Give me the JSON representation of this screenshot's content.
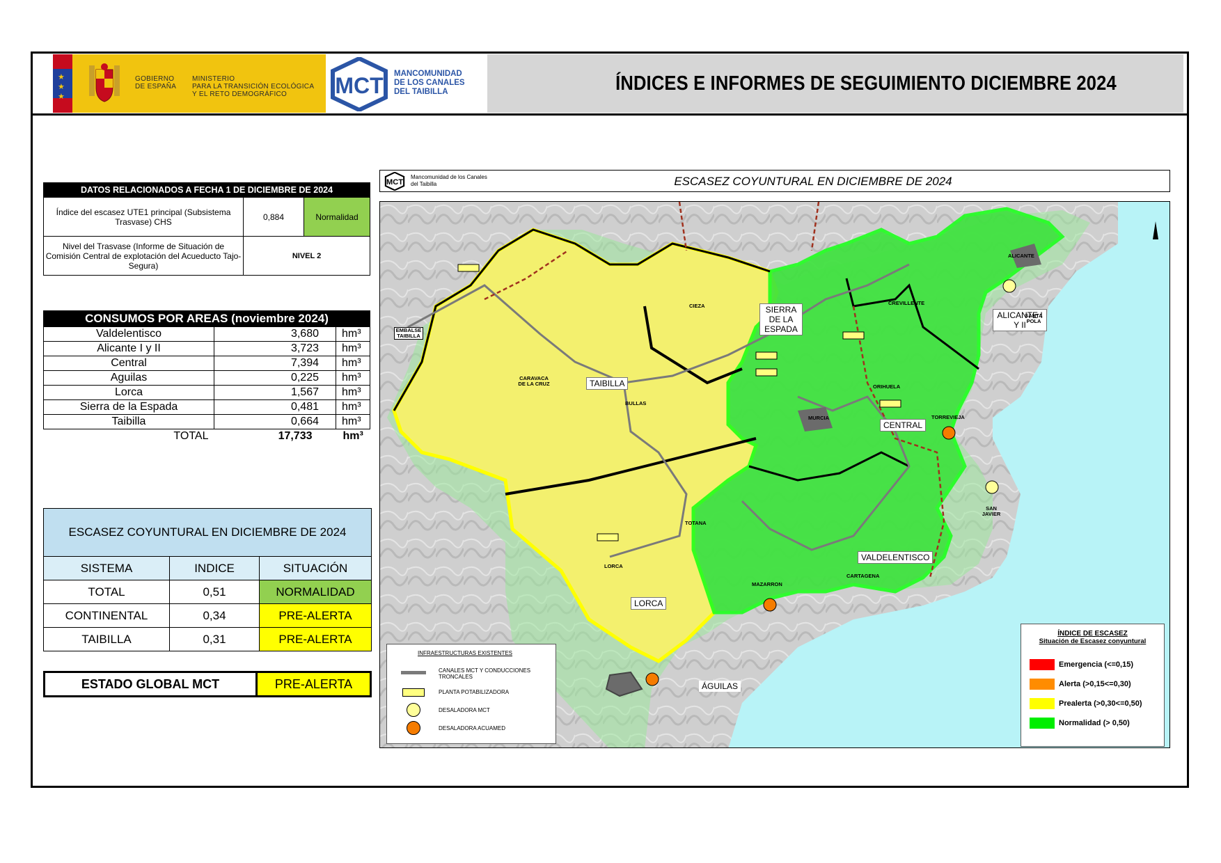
{
  "header": {
    "gobierno_line1": "GOBIERNO",
    "gobierno_line2": "DE ESPAÑA",
    "ministerio_line1": "MINISTERIO",
    "ministerio_line2": "PARA LA TRANSICIÓN ECOLÓGICA",
    "ministerio_line3": "Y EL RETO DEMOGRÁFICO",
    "mct_line1": "MANCOMUNIDAD",
    "mct_line2": "DE LOS CANALES",
    "mct_line3": "DEL TAIBILLA",
    "mct_logo_text": "MCT",
    "title": "ÍNDICES E INFORMES DE SEGUIMIENTO DICIEMBRE 2024"
  },
  "datos": {
    "title": "DATOS RELACIONADOS A FECHA 1 DE DICIEMBRE DE 2024",
    "row1_label": "Índice del escasez UTE1 principal (Subsistema Trasvase) CHS",
    "row1_value": "0,884",
    "row1_status": "Normalidad",
    "row2_label": "Nivel del Trasvase (Informe de Situación de Comisión Central de explotación del Acueducto Tajo-Segura)",
    "row2_value": "NIVEL 2"
  },
  "consumos": {
    "title": "CONSUMOS POR AREAS (noviembre 2024)",
    "rows": [
      {
        "area": "Valdelentisco",
        "value": "3,680",
        "unit": "hm³"
      },
      {
        "area": "Alicante I y II",
        "value": "3,723",
        "unit": "hm³"
      },
      {
        "area": "Central",
        "value": "7,394",
        "unit": "hm³"
      },
      {
        "area": "Aguilas",
        "value": "0,225",
        "unit": "hm³"
      },
      {
        "area": "Lorca",
        "value": "1,567",
        "unit": "hm³"
      },
      {
        "area": "Sierra de la Espada",
        "value": "0,481",
        "unit": "hm³"
      },
      {
        "area": "Taibilla",
        "value": "0,664",
        "unit": "hm³"
      }
    ],
    "total_label": "TOTAL",
    "total_value": "17,733",
    "total_unit": "hm³"
  },
  "escasez": {
    "title": "ESCASEZ COYUNTURAL EN DICIEMBRE DE 2024",
    "col_sistema": "SISTEMA",
    "col_indice": "INDICE",
    "col_situacion": "SITUACIÓN",
    "rows": [
      {
        "sistema": "TOTAL",
        "indice": "0,51",
        "situacion": "NORMALIDAD",
        "color": "#92d050"
      },
      {
        "sistema": "CONTINENTAL",
        "indice": "0,34",
        "situacion": "PRE-ALERTA",
        "color": "#ffff00"
      },
      {
        "sistema": "TAIBILLA",
        "indice": "0,31",
        "situacion": "PRE-ALERTA",
        "color": "#ffff00"
      }
    ]
  },
  "estado": {
    "label": "ESTADO GLOBAL MCT",
    "value": "PRE-ALERTA",
    "color": "#ffff00"
  },
  "map": {
    "logo_text": "MCT",
    "logo_caption": "Mancomunidad de los Canales del Taibilla",
    "title": "ESCASEZ COYUNTURAL EN DICIEMBRE DE 2024",
    "zones": {
      "sierra": "SIERRA DE LA ESPADA",
      "taibilla": "TAIBILLA",
      "alicante": "ALICANTE I Y II",
      "central": "CENTRAL",
      "valdelentisco": "VALDELENTISCO",
      "lorca": "LORCA",
      "aguilas": "ÁGUILAS"
    },
    "towns": {
      "embalse": "EMBALSE TAIBILLA",
      "cieza": "CIEZA",
      "caravaca": "CARAVACA DE LA CRUZ",
      "bullas": "BULLAS",
      "murcia": "MURCIA",
      "orihuela": "ORIHUELA",
      "crevillente": "CREVILLENTE",
      "alicante": "ALICANTE",
      "santa_pola": "SANTA POLA",
      "torrevieja": "TORREVIEJA",
      "totana": "TOTANA",
      "lorca": "LORCA",
      "mazarron": "MAZARRON",
      "cartagena": "CARTAGENA",
      "san_javier": "SAN JAVIER"
    },
    "legend_infra": {
      "title": "INFRAESTRUCTURAS EXISTENTES",
      "canales": "CANALES MCT Y CONDUCCIONES TRONCALES",
      "planta": "PLANTA POTABILIZADORA",
      "desal_mct": "DESALADORA MCT",
      "desal_acuamed": "DESALADORA ACUAMED"
    },
    "legend_index": {
      "title": "ÍNDICE DE ESCASEZ",
      "subtitle": "Situación de Escasez conyuntural",
      "items": [
        {
          "label": "Emergencia (<=0,15)",
          "color": "#ff0000"
        },
        {
          "label": "Alerta (>0,15<=0,30)",
          "color": "#ff8c00"
        },
        {
          "label": "Prealerta (>0,30<=0,50)",
          "color": "#ffff00"
        },
        {
          "label": "Normalidad (> 0,50)",
          "color": "#00ee00"
        }
      ]
    }
  }
}
